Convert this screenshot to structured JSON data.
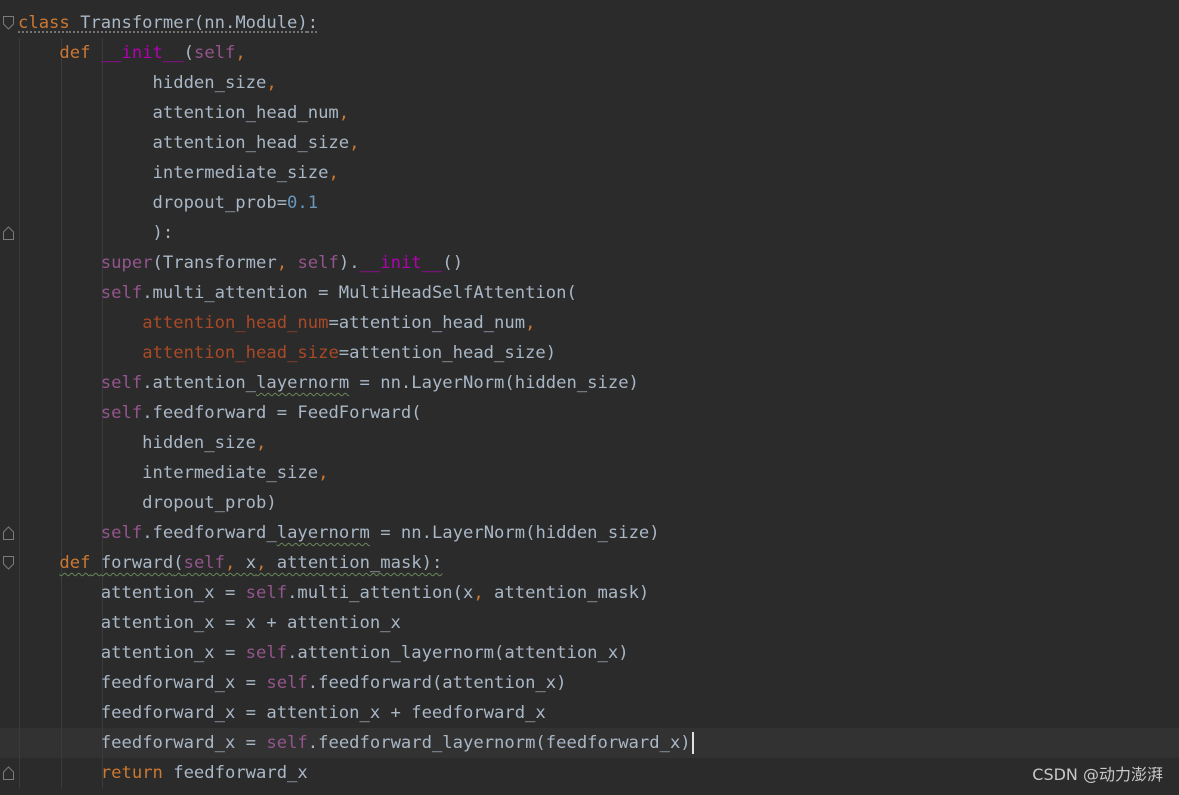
{
  "watermark": "CSDN @动力澎湃",
  "colors": {
    "background": "#2b2b2b",
    "current_line": "#323232",
    "keyword": "#cc7832",
    "self": "#94558d",
    "dunder": "#b200b2",
    "number": "#6897bb",
    "kwarg": "#aa4926",
    "function_name": "#ffc66d",
    "plain": "#a9b7c6"
  },
  "icons": {
    "fold_open": "fold-open-icon",
    "fold_close": "fold-close-icon"
  },
  "lines": [
    {
      "indent": 0,
      "fold": "open",
      "tokens": [
        {
          "t": "class",
          "c": "keyword",
          "u": "dotted"
        },
        {
          "t": " Transformer(nn.Module)",
          "c": "plain",
          "u": "dotted"
        },
        {
          "t": ":",
          "c": "plain",
          "u": "dotted"
        }
      ]
    },
    {
      "indent": 1,
      "tokens": [
        {
          "t": "def ",
          "c": "keyword"
        },
        {
          "t": "__init__",
          "c": "dunder"
        },
        {
          "t": "(",
          "c": "plain"
        },
        {
          "t": "self",
          "c": "self"
        },
        {
          "t": ",",
          "c": "punct"
        }
      ]
    },
    {
      "indent": 0,
      "tokens": [
        {
          "t": "             hidden_size",
          "c": "plain"
        },
        {
          "t": ",",
          "c": "punct"
        }
      ]
    },
    {
      "indent": 0,
      "tokens": [
        {
          "t": "             attention_head_num",
          "c": "plain"
        },
        {
          "t": ",",
          "c": "punct"
        }
      ]
    },
    {
      "indent": 0,
      "tokens": [
        {
          "t": "             attention_head_size",
          "c": "plain"
        },
        {
          "t": ",",
          "c": "punct"
        }
      ]
    },
    {
      "indent": 0,
      "tokens": [
        {
          "t": "             intermediate_size",
          "c": "plain"
        },
        {
          "t": ",",
          "c": "punct"
        }
      ]
    },
    {
      "indent": 0,
      "tokens": [
        {
          "t": "             dropout_prob=",
          "c": "plain"
        },
        {
          "t": "0.1",
          "c": "number"
        }
      ]
    },
    {
      "indent": 0,
      "fold": "close",
      "tokens": [
        {
          "t": "             ):",
          "c": "plain"
        }
      ]
    },
    {
      "indent": 2,
      "tokens": [
        {
          "t": "super",
          "c": "self"
        },
        {
          "t": "(Transformer",
          "c": "plain"
        },
        {
          "t": ", ",
          "c": "punct"
        },
        {
          "t": "self",
          "c": "self"
        },
        {
          "t": ").",
          "c": "plain"
        },
        {
          "t": "__init__",
          "c": "dunder"
        },
        {
          "t": "()",
          "c": "plain"
        }
      ]
    },
    {
      "indent": 2,
      "tokens": [
        {
          "t": "self",
          "c": "self"
        },
        {
          "t": ".multi_attention = MultiHeadSelfAttention(",
          "c": "plain"
        }
      ]
    },
    {
      "indent": 3,
      "tokens": [
        {
          "t": "attention_head_num",
          "c": "kwarg"
        },
        {
          "t": "=attention_head_num",
          "c": "plain"
        },
        {
          "t": ",",
          "c": "punct"
        }
      ]
    },
    {
      "indent": 3,
      "tokens": [
        {
          "t": "attention_head_size",
          "c": "kwarg"
        },
        {
          "t": "=attention_head_size)",
          "c": "plain"
        }
      ]
    },
    {
      "indent": 2,
      "tokens": [
        {
          "t": "self",
          "c": "self"
        },
        {
          "t": ".attention_",
          "c": "plain"
        },
        {
          "t": "layernorm",
          "c": "plain",
          "u": "wavy"
        },
        {
          "t": " = nn.LayerNorm(hidden_size)",
          "c": "plain"
        }
      ]
    },
    {
      "indent": 2,
      "tokens": [
        {
          "t": "self",
          "c": "self"
        },
        {
          "t": ".feedforward = FeedForward(",
          "c": "plain"
        }
      ]
    },
    {
      "indent": 0,
      "tokens": [
        {
          "t": "            hidden_size",
          "c": "plain"
        },
        {
          "t": ",",
          "c": "punct"
        }
      ]
    },
    {
      "indent": 0,
      "tokens": [
        {
          "t": "            intermediate_size",
          "c": "plain"
        },
        {
          "t": ",",
          "c": "punct"
        }
      ]
    },
    {
      "indent": 0,
      "tokens": [
        {
          "t": "            dropout_prob)",
          "c": "plain"
        }
      ]
    },
    {
      "indent": 2,
      "fold": "close",
      "tokens": [
        {
          "t": "self",
          "c": "self"
        },
        {
          "t": ".feedforward_",
          "c": "plain"
        },
        {
          "t": "layernorm",
          "c": "plain",
          "u": "wavy"
        },
        {
          "t": " = nn.LayerNorm(hidden_size)",
          "c": "plain"
        }
      ]
    },
    {
      "indent": 1,
      "fold": "open",
      "tokens": [
        {
          "t": "def",
          "c": "keyword",
          "u": "wavy"
        },
        {
          "t": " ",
          "c": "plain",
          "u": "wavy"
        },
        {
          "t": "forward",
          "c": "function_name",
          "u": "wavy"
        },
        {
          "t": "(",
          "c": "plain",
          "u": "wavy"
        },
        {
          "t": "self",
          "c": "self",
          "u": "wavy"
        },
        {
          "t": ", ",
          "c": "punct",
          "u": "wavy"
        },
        {
          "t": "x",
          "c": "plain",
          "u": "wavy"
        },
        {
          "t": ", ",
          "c": "punct",
          "u": "wavy"
        },
        {
          "t": "attention_mask):",
          "c": "plain",
          "u": "wavy"
        }
      ]
    },
    {
      "indent": 2,
      "tokens": [
        {
          "t": "attention_x = ",
          "c": "plain"
        },
        {
          "t": "self",
          "c": "self"
        },
        {
          "t": ".multi_attention(x",
          "c": "plain"
        },
        {
          "t": ", ",
          "c": "punct"
        },
        {
          "t": "attention_mask)",
          "c": "plain"
        }
      ]
    },
    {
      "indent": 2,
      "tokens": [
        {
          "t": "attention_x = x + attention_x",
          "c": "plain"
        }
      ]
    },
    {
      "indent": 2,
      "tokens": [
        {
          "t": "attention_x = ",
          "c": "plain"
        },
        {
          "t": "self",
          "c": "self"
        },
        {
          "t": ".attention_layernorm(attention_x)",
          "c": "plain"
        }
      ]
    },
    {
      "indent": 2,
      "tokens": [
        {
          "t": "feedforward_x = ",
          "c": "plain"
        },
        {
          "t": "self",
          "c": "self"
        },
        {
          "t": ".feedforward(attention_x)",
          "c": "plain"
        }
      ]
    },
    {
      "indent": 2,
      "tokens": [
        {
          "t": "feedforward_x = attention_x + feedforward_x",
          "c": "plain"
        }
      ]
    },
    {
      "indent": 2,
      "current": true,
      "tokens": [
        {
          "t": "feedforward_x = ",
          "c": "plain"
        },
        {
          "t": "self",
          "c": "self"
        },
        {
          "t": ".feedforward_layernorm(feedforward_x)",
          "c": "plain"
        }
      ]
    },
    {
      "indent": 2,
      "fold": "close",
      "tokens": [
        {
          "t": "return ",
          "c": "keyword"
        },
        {
          "t": "feedforward_x",
          "c": "plain"
        }
      ]
    }
  ]
}
